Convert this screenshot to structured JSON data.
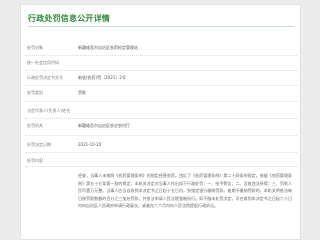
{
  "page": {
    "title": "行政处罚信息公开详情"
  },
  "rows": [
    {
      "label": "处罚对象",
      "value": "新疆维吾尔自治区农药检定管理站"
    },
    {
      "label": "统一社会信用代码",
      "value": ""
    },
    {
      "label": "行政处罚决定书文号",
      "value": "新农(农药)罚〔2021〕2号"
    },
    {
      "label": "处罚类别",
      "value": "罚款"
    },
    {
      "label": "法定代表人(负责人)姓名",
      "value": ""
    },
    {
      "label": "处罚机关",
      "value": "新疆维吾尔自治区农业农村厅"
    },
    {
      "label": "处罚决定日期",
      "value": "2021-10-20"
    },
    {
      "label": "处罚内容",
      "value": ""
    }
  ],
  "content_text": "经查，当事人未按照《农药管理条例》的规定经营农药，违反了《农药管理条例》第二十四条的规定。依据《农药管理条例》第五十七条第一款的规定，本机关决定对当事人作出如下行政处罚：一、给予警告；二、没收违法所得；三、罚款人民币壹万元整。当事人应当自收到本决定书之日起十五日内，到指定银行缴纳罚款。逾期不缴纳罚款的，本机关将依法每日按罚款数额的百分之三加处罚款，并依法申请人民法院强制执行。如不服本处罚决定，可在收到本决定书之日起六十日内向自治区人民政府申请行政复议，或者在六个月内向人民法院提起行政诉讼。"
}
